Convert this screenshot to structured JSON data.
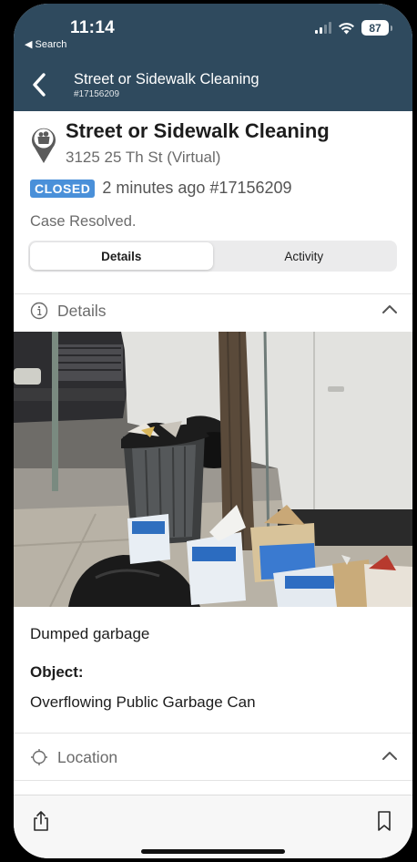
{
  "status_bar": {
    "time": "11:14",
    "back_app": "◀ Search",
    "battery": "87"
  },
  "nav": {
    "title": "Street or Sidewalk Cleaning",
    "subtitle": "#17156209"
  },
  "case": {
    "title": "Street or Sidewalk Cleaning",
    "address": "3125 25 Th St (Virtual)",
    "status_badge": "CLOSED",
    "status_meta": "2 minutes ago #17156209",
    "resolution": "Case Resolved."
  },
  "tabs": [
    {
      "label": "Details",
      "active": true
    },
    {
      "label": "Activity",
      "active": false
    }
  ],
  "details_section": {
    "label": "Details"
  },
  "photo": {
    "description_alt": "street photo"
  },
  "fields": {
    "description": "Dumped garbage",
    "object_label": "Object:",
    "object_value": "Overflowing Public Garbage Can"
  },
  "location_section": {
    "label": "Location"
  },
  "colors": {
    "nav_bar": "#2f4a5e",
    "badge": "#4a90d9"
  },
  "icons": [
    "back-chevron-icon",
    "wifi-icon",
    "signal-icon",
    "battery-icon",
    "case-pin-icon",
    "info-icon",
    "chevron-up-icon",
    "location-icon",
    "share-icon",
    "bookmark-icon"
  ]
}
